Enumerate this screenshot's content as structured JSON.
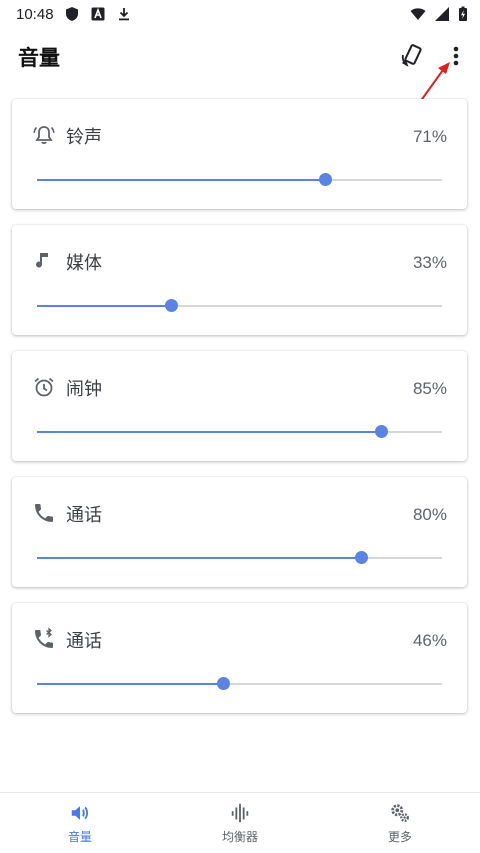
{
  "status_bar": {
    "time": "10:48",
    "icons": [
      "shield-icon",
      "a-badge-icon",
      "download-icon",
      "wifi-icon",
      "signal-icon",
      "battery-charging-icon"
    ]
  },
  "app_bar": {
    "title": "音量",
    "actions": [
      "rotate-phone-icon",
      "more-vert-icon"
    ]
  },
  "cards": [
    {
      "id": "ringtone",
      "icon": "bell-icon",
      "label": "铃声",
      "value_text": "71%",
      "level": 0.71
    },
    {
      "id": "media",
      "icon": "music-note-icon",
      "label": "媒体",
      "value_text": "33%",
      "level": 0.33
    },
    {
      "id": "alarm",
      "icon": "alarm-clock-icon",
      "label": "闹钟",
      "value_text": "85%",
      "level": 0.85
    },
    {
      "id": "call",
      "icon": "phone-icon",
      "label": "通话",
      "value_text": "80%",
      "level": 0.8
    },
    {
      "id": "bt-call",
      "icon": "bluetooth-phone-icon",
      "label": "通话",
      "value_text": "46%",
      "level": 0.46
    }
  ],
  "bottom_nav": [
    {
      "id": "volume",
      "icon": "speaker-icon",
      "label": "音量",
      "active": true
    },
    {
      "id": "equalizer",
      "icon": "equalizer-bars-icon",
      "label": "均衡器",
      "active": false
    },
    {
      "id": "more",
      "icon": "gears-icon",
      "label": "更多",
      "active": false
    }
  ],
  "colors": {
    "accent": "#5b84e2",
    "nav_active": "#4a79e6",
    "track": "#d6d6d6",
    "annotation_arrow": "#e02020"
  }
}
